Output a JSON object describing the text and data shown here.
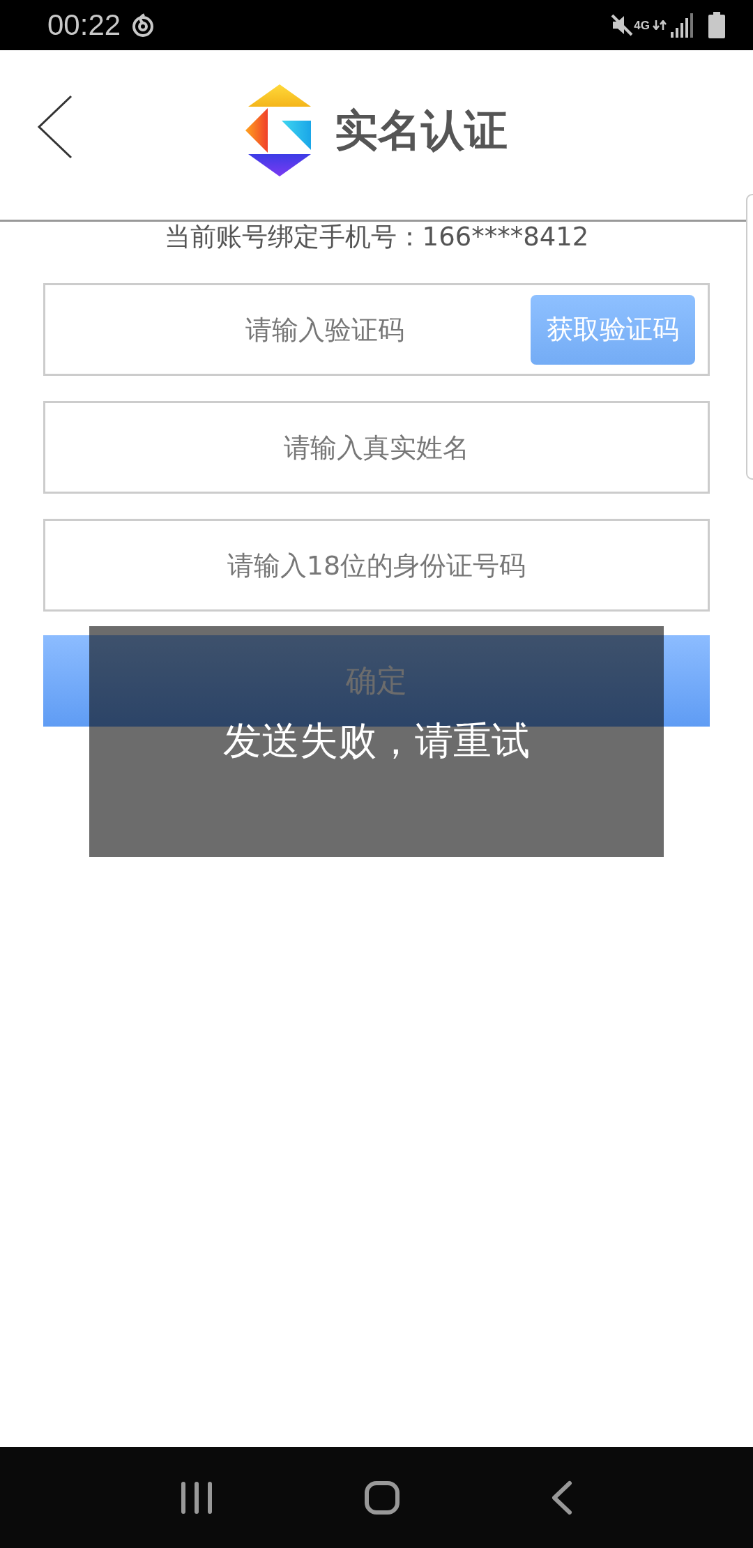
{
  "status_bar": {
    "time": "00:22",
    "network": "4G"
  },
  "header": {
    "title": "实名认证"
  },
  "phone_notice": "当前账号绑定手机号：166****8412",
  "fields": [
    {
      "kind": "code",
      "placeholder": "请输入验证码",
      "button": "获取验证码"
    },
    {
      "kind": "text",
      "placeholder": "请输入真实姓名"
    },
    {
      "kind": "text",
      "placeholder": "请输入18位的身份证号码"
    }
  ],
  "confirm_button": "确定",
  "toast": "发送失败，请重试"
}
